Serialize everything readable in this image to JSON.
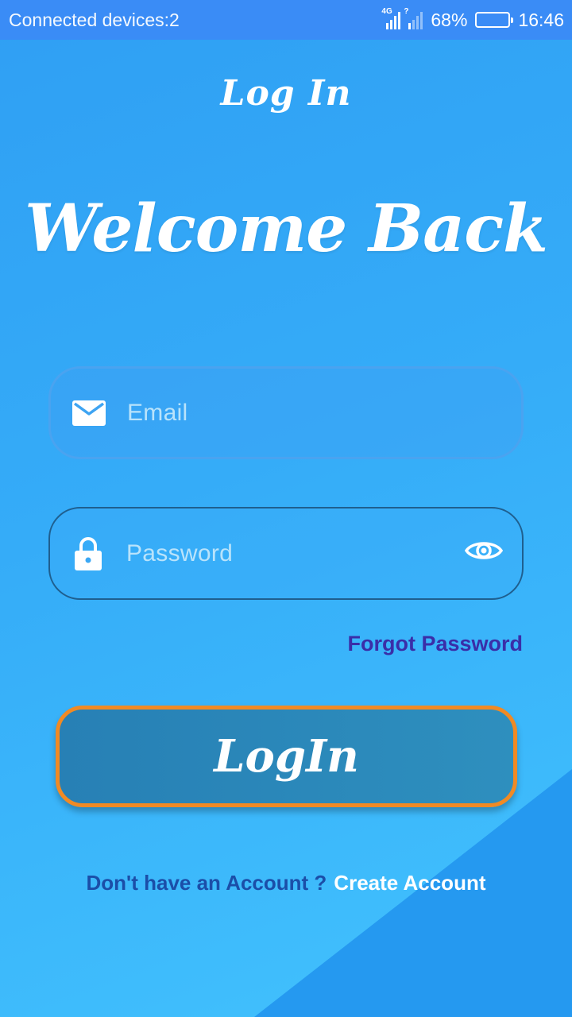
{
  "status_bar": {
    "left_text": "Connected devices:2",
    "network_label": "4G",
    "sim2_label": "?",
    "battery_percent": "68%",
    "battery_level": 0.68,
    "time": "16:46"
  },
  "header": {
    "title": "Log In"
  },
  "hero": {
    "welcome_text": "Welcome Back"
  },
  "form": {
    "email": {
      "placeholder": "Email",
      "value": "",
      "icon": "mail-icon"
    },
    "password": {
      "placeholder": "Password",
      "value": "",
      "icon": "lock-icon",
      "toggle_icon": "eye-icon"
    },
    "forgot_password_label": "Forgot Password",
    "submit_label": "LogIn"
  },
  "signup": {
    "prompt": "Don't have an Account ?",
    "link_label": "Create Account"
  },
  "colors": {
    "background_top": "#2f9ff3",
    "background_bottom": "#42c2fd",
    "status_bar": "#3a8cf6",
    "button_fill": "#2e8fbe",
    "button_border": "#f08a24",
    "forgot_link": "#3a2ea8",
    "signup_prompt": "#1b4ea8",
    "placeholder": "#b9e3fb"
  }
}
